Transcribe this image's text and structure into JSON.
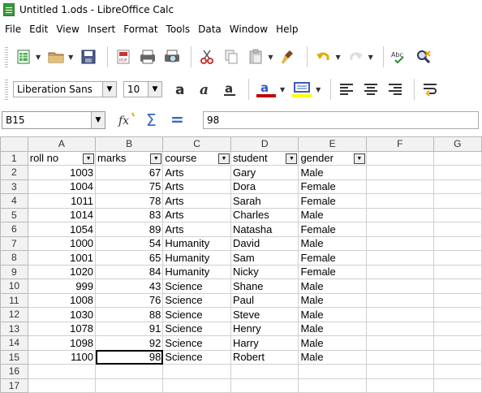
{
  "window": {
    "title": "Untitled 1.ods - LibreOffice Calc"
  },
  "menu": [
    "File",
    "Edit",
    "View",
    "Insert",
    "Format",
    "Tools",
    "Data",
    "Window",
    "Help"
  ],
  "formatting": {
    "font_name": "Liberation Sans",
    "font_size": "10"
  },
  "formula_bar": {
    "cell_ref": "B15",
    "content": "98"
  },
  "columns": [
    "A",
    "B",
    "C",
    "D",
    "E",
    "F",
    "G"
  ],
  "selected_column": "B",
  "selected_row": "15",
  "headers": [
    "roll no",
    "marks",
    "course",
    "student",
    "gender"
  ],
  "rows": [
    {
      "n": "1",
      "cells": [
        "roll no",
        "marks",
        "course",
        "student",
        "gender"
      ]
    },
    {
      "n": "2",
      "cells": [
        "1003",
        "67",
        "Arts",
        "Gary",
        "Male"
      ]
    },
    {
      "n": "3",
      "cells": [
        "1004",
        "75",
        "Arts",
        "Dora",
        "Female"
      ]
    },
    {
      "n": "4",
      "cells": [
        "1011",
        "78",
        "Arts",
        "Sarah",
        "Female"
      ]
    },
    {
      "n": "5",
      "cells": [
        "1014",
        "83",
        "Arts",
        "Charles",
        "Male"
      ]
    },
    {
      "n": "6",
      "cells": [
        "1054",
        "89",
        "Arts",
        "Natasha",
        "Female"
      ]
    },
    {
      "n": "7",
      "cells": [
        "1000",
        "54",
        "Humanity",
        "David",
        "Male"
      ]
    },
    {
      "n": "8",
      "cells": [
        "1001",
        "65",
        "Humanity",
        "Sam",
        "Female"
      ]
    },
    {
      "n": "9",
      "cells": [
        "1020",
        "84",
        "Humanity",
        "Nicky",
        "Female"
      ]
    },
    {
      "n": "10",
      "cells": [
        "999",
        "43",
        "Science",
        "Shane",
        "Male"
      ]
    },
    {
      "n": "11",
      "cells": [
        "1008",
        "76",
        "Science",
        "Paul",
        "Male"
      ]
    },
    {
      "n": "12",
      "cells": [
        "1030",
        "88",
        "Science",
        "Steve",
        "Male"
      ]
    },
    {
      "n": "13",
      "cells": [
        "1078",
        "91",
        "Science",
        "Henry",
        "Male"
      ]
    },
    {
      "n": "14",
      "cells": [
        "1098",
        "92",
        "Science",
        "Harry",
        "Male"
      ]
    },
    {
      "n": "15",
      "cells": [
        "1100",
        "98",
        "Science",
        "Robert",
        "Male"
      ]
    },
    {
      "n": "16",
      "cells": [
        "",
        "",
        "",
        "",
        ""
      ]
    },
    {
      "n": "17",
      "cells": [
        "",
        "",
        "",
        "",
        ""
      ]
    }
  ],
  "colors": {
    "selection": "#4a90d9",
    "header_bg": "#f2f2f2",
    "highlight_yellow": "#ffff00",
    "font_red": "#c00000"
  },
  "icons": [
    "new-spreadsheet-icon",
    "open-folder-icon",
    "save-icon",
    "export-pdf-icon",
    "print-icon",
    "print-preview-icon",
    "cut-icon",
    "copy-icon",
    "paste-icon",
    "clone-formatting-icon",
    "undo-icon",
    "redo-icon",
    "spellcheck-icon",
    "find-replace-icon",
    "bold-icon",
    "italic-icon",
    "underline-icon",
    "font-color-icon",
    "highlight-icon",
    "align-left-icon",
    "align-center-icon",
    "align-right-icon",
    "wrap-text-icon",
    "function-wizard-icon",
    "sum-icon",
    "formula-icon"
  ]
}
